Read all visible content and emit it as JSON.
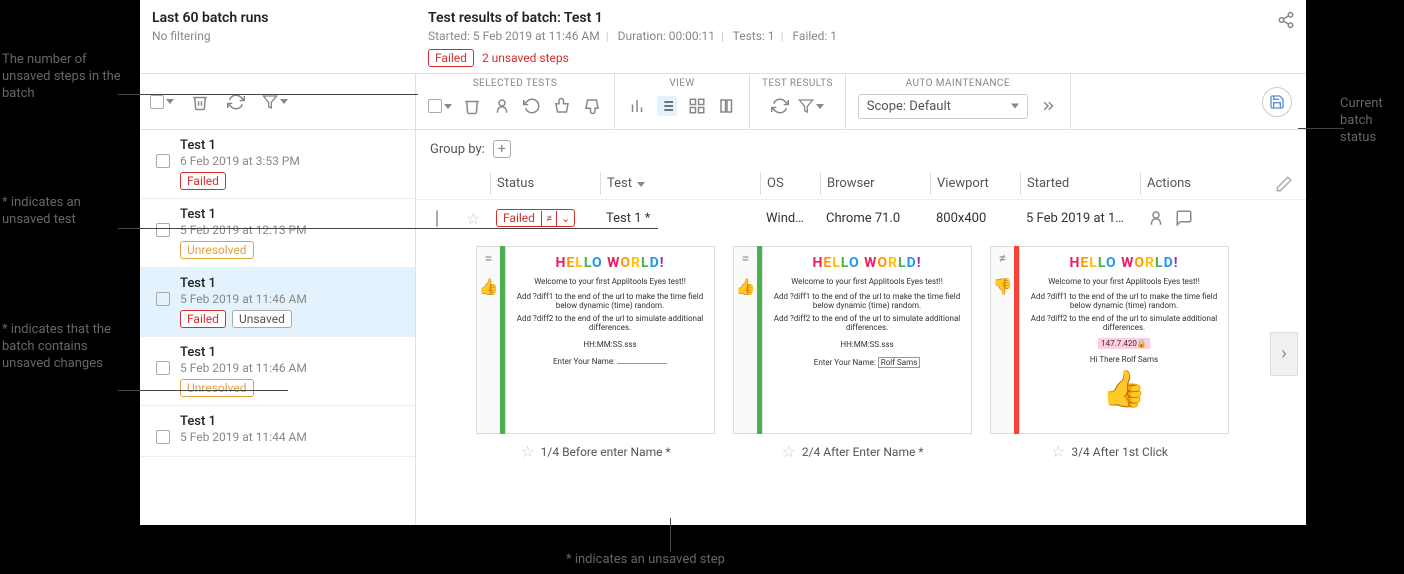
{
  "annotations": {
    "unsavedCount": "The number of unsaved steps in the batch",
    "unsavedTest": "* indicates an unsaved test",
    "batchUnsaved": "* indicates that the batch contains unsaved changes",
    "stepUnsaved": "* indicates an unsaved step",
    "batchStatus": "Current batch status"
  },
  "sidebar": {
    "title": "Last 60 batch runs",
    "filter": "No filtering",
    "items": [
      {
        "name": "Test 1",
        "date": "6 Feb 2019 at 3:53 PM",
        "badges": [
          "Failed"
        ]
      },
      {
        "name": "Test 1",
        "date": "5 Feb 2019 at 12:13 PM",
        "badges": [
          "Unresolved"
        ]
      },
      {
        "name": "Test 1",
        "date": "5 Feb 2019 at 11:46 AM",
        "badges": [
          "Failed",
          "Unsaved"
        ],
        "selected": true
      },
      {
        "name": "Test 1",
        "date": "5 Feb 2019 at 11:46 AM",
        "badges": [
          "Unresolved"
        ]
      },
      {
        "name": "Test 1",
        "date": "5 Feb 2019 at 11:44 AM",
        "badges": []
      }
    ]
  },
  "details": {
    "titlePrefix": "Test results of batch:  ",
    "batchName": "Test 1",
    "started": "Started: 5 Feb 2019 at 11:46 AM",
    "duration": "Duration: 00:00:11",
    "tests": "Tests: 1",
    "failed": "Failed: 1",
    "statusBadge": "Failed",
    "unsavedSteps": "2 unsaved steps"
  },
  "toolbar": {
    "sections": {
      "selected": "SELECTED TESTS",
      "view": "VIEW",
      "results": "TEST RESULTS",
      "auto": "AUTO MAINTENANCE"
    },
    "scope": "Scope: Default"
  },
  "groupBy": "Group by:",
  "columns": {
    "status": "Status",
    "test": "Test",
    "os": "OS",
    "browser": "Browser",
    "viewport": "Viewport",
    "started": "Started",
    "actions": "Actions"
  },
  "row": {
    "status": "Failed",
    "test": "Test 1 *",
    "os": "Wind…",
    "browser": "Chrome 71.0",
    "viewport": "800x400",
    "started": "5 Feb 2019 at 1…"
  },
  "thumbs": [
    {
      "eq": "=",
      "vote": "up",
      "bar": "green",
      "caption": "1/4 Before enter Name *",
      "variant": "a"
    },
    {
      "eq": "=",
      "vote": "up",
      "bar": "green",
      "caption": "2/4 After Enter Name *",
      "variant": "b"
    },
    {
      "eq": "≠",
      "vote": "down",
      "bar": "red",
      "caption": "3/4 After 1st Click",
      "variant": "c"
    }
  ],
  "thumbContent": {
    "hello": "HELLO WORLD!",
    "welcome": "Welcome to your first Applitools Eyes test!!",
    "line1a": "Add ?diff1 to the end of the url to make the time field below dynamic (time) random.",
    "line1b": "Add ?diff2 to the end of the url to simulate additional differences.",
    "time": "HH:MM:SS.sss",
    "nameLabel": "Enter Your Name:",
    "nameVal": "Rolf Sams",
    "ip": "147.7.420",
    "hi": "Hi There Rolf Sams"
  }
}
